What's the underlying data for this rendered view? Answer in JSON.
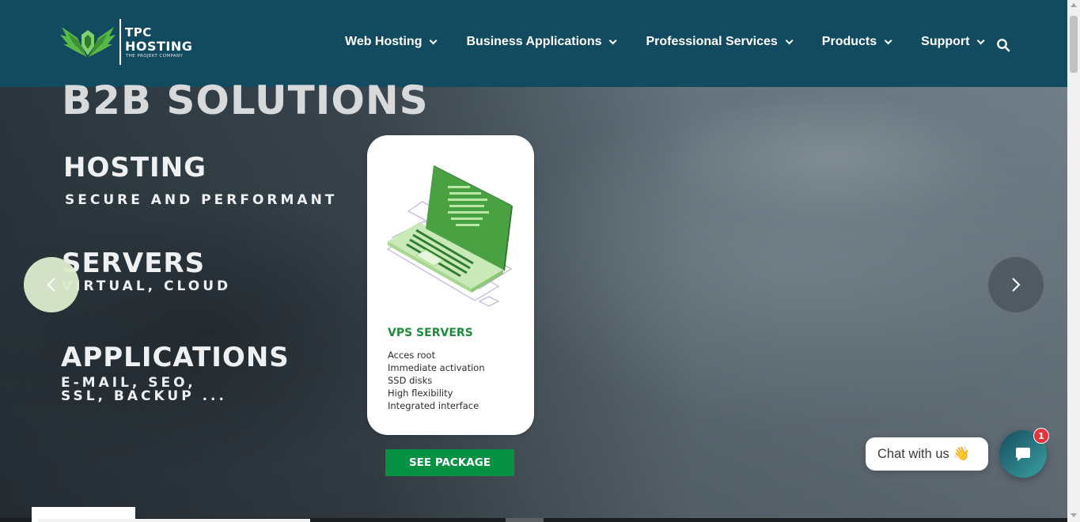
{
  "header": {
    "logo": {
      "line1": "TPC",
      "line2": "HOSTING",
      "tagline": "THE PROJEKT COMPANY",
      "icon": "winged-shield-logo-icon"
    },
    "nav": [
      {
        "label": "Web Hosting"
      },
      {
        "label": "Business Applications"
      },
      {
        "label": "Professional Services"
      },
      {
        "label": "Products"
      },
      {
        "label": "Support"
      }
    ],
    "search_icon": "search-icon"
  },
  "hero": {
    "headline": "B2B SOLUTIONS",
    "hosting": "HOSTING",
    "hosting_sub": "SECURE AND PERFORMANT",
    "servers": "SERVERS",
    "servers_sub": "VIRTUAL, CLOUD",
    "applications": "APPLICATIONS",
    "applications_sub1": "E-MAIL, SEO,",
    "applications_sub2": "SSL, BACKUP ..."
  },
  "card": {
    "title": "VPS SERVERS",
    "features": [
      "Acces root",
      "Immediate activation",
      "SSD disks",
      "High flexibility",
      "Integrated interface"
    ],
    "illustration": "laptop-icon",
    "cta_label": "SEE PACKAGE"
  },
  "slider": {
    "prev_icon": "chevron-left-icon",
    "next_icon": "chevron-right-icon"
  },
  "chat": {
    "bubble_text": "Chat with us",
    "wave_emoji": "👋",
    "badge_count": "1",
    "launcher_icon": "chat-icon"
  },
  "colors": {
    "header_bg": "#124a5f",
    "accent_green": "#079143",
    "card_title_green": "#1e8b3a",
    "badge_red": "#e5343d"
  }
}
